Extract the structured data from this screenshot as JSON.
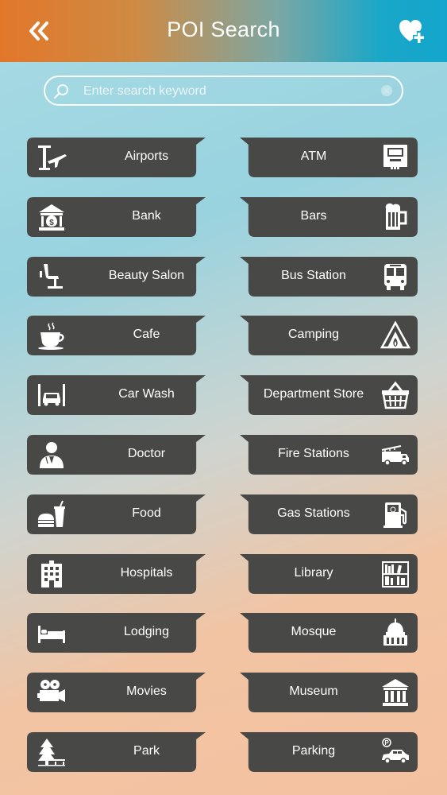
{
  "header": {
    "title": "POI Search",
    "back_icon": "double-chevron-left-icon",
    "favorite_icon": "heart-plus-icon",
    "colors": {
      "left": "#e2772a",
      "right": "#13a6cc"
    }
  },
  "search": {
    "placeholder": "Enter search keyword",
    "value": "",
    "icon": "search-icon"
  },
  "tile_color": "#484947",
  "categories": {
    "left": [
      {
        "label": "Airports",
        "icon": "airport-icon"
      },
      {
        "label": "Bank",
        "icon": "bank-icon"
      },
      {
        "label": "Beauty Salon",
        "icon": "salon-chair-icon"
      },
      {
        "label": "Cafe",
        "icon": "coffee-cup-icon"
      },
      {
        "label": "Car Wash",
        "icon": "car-wash-icon"
      },
      {
        "label": "Doctor",
        "icon": "doctor-icon"
      },
      {
        "label": "Food",
        "icon": "fast-food-icon"
      },
      {
        "label": "Hospitals",
        "icon": "hospital-icon"
      },
      {
        "label": "Lodging",
        "icon": "bed-icon"
      },
      {
        "label": "Movies",
        "icon": "film-projector-icon"
      },
      {
        "label": "Park",
        "icon": "tree-bench-icon"
      }
    ],
    "right": [
      {
        "label": "ATM",
        "icon": "atm-icon"
      },
      {
        "label": "Bars",
        "icon": "beer-mug-icon"
      },
      {
        "label": "Bus Station",
        "icon": "bus-icon"
      },
      {
        "label": "Camping",
        "icon": "tent-icon"
      },
      {
        "label": "Department Store",
        "icon": "shopping-basket-icon"
      },
      {
        "label": "Fire Stations",
        "icon": "fire-truck-icon"
      },
      {
        "label": "Gas Stations",
        "icon": "gas-pump-icon"
      },
      {
        "label": "Library",
        "icon": "bookshelf-icon"
      },
      {
        "label": "Mosque",
        "icon": "mosque-dome-icon"
      },
      {
        "label": "Museum",
        "icon": "museum-icon"
      },
      {
        "label": "Parking",
        "icon": "parking-car-icon"
      }
    ]
  }
}
